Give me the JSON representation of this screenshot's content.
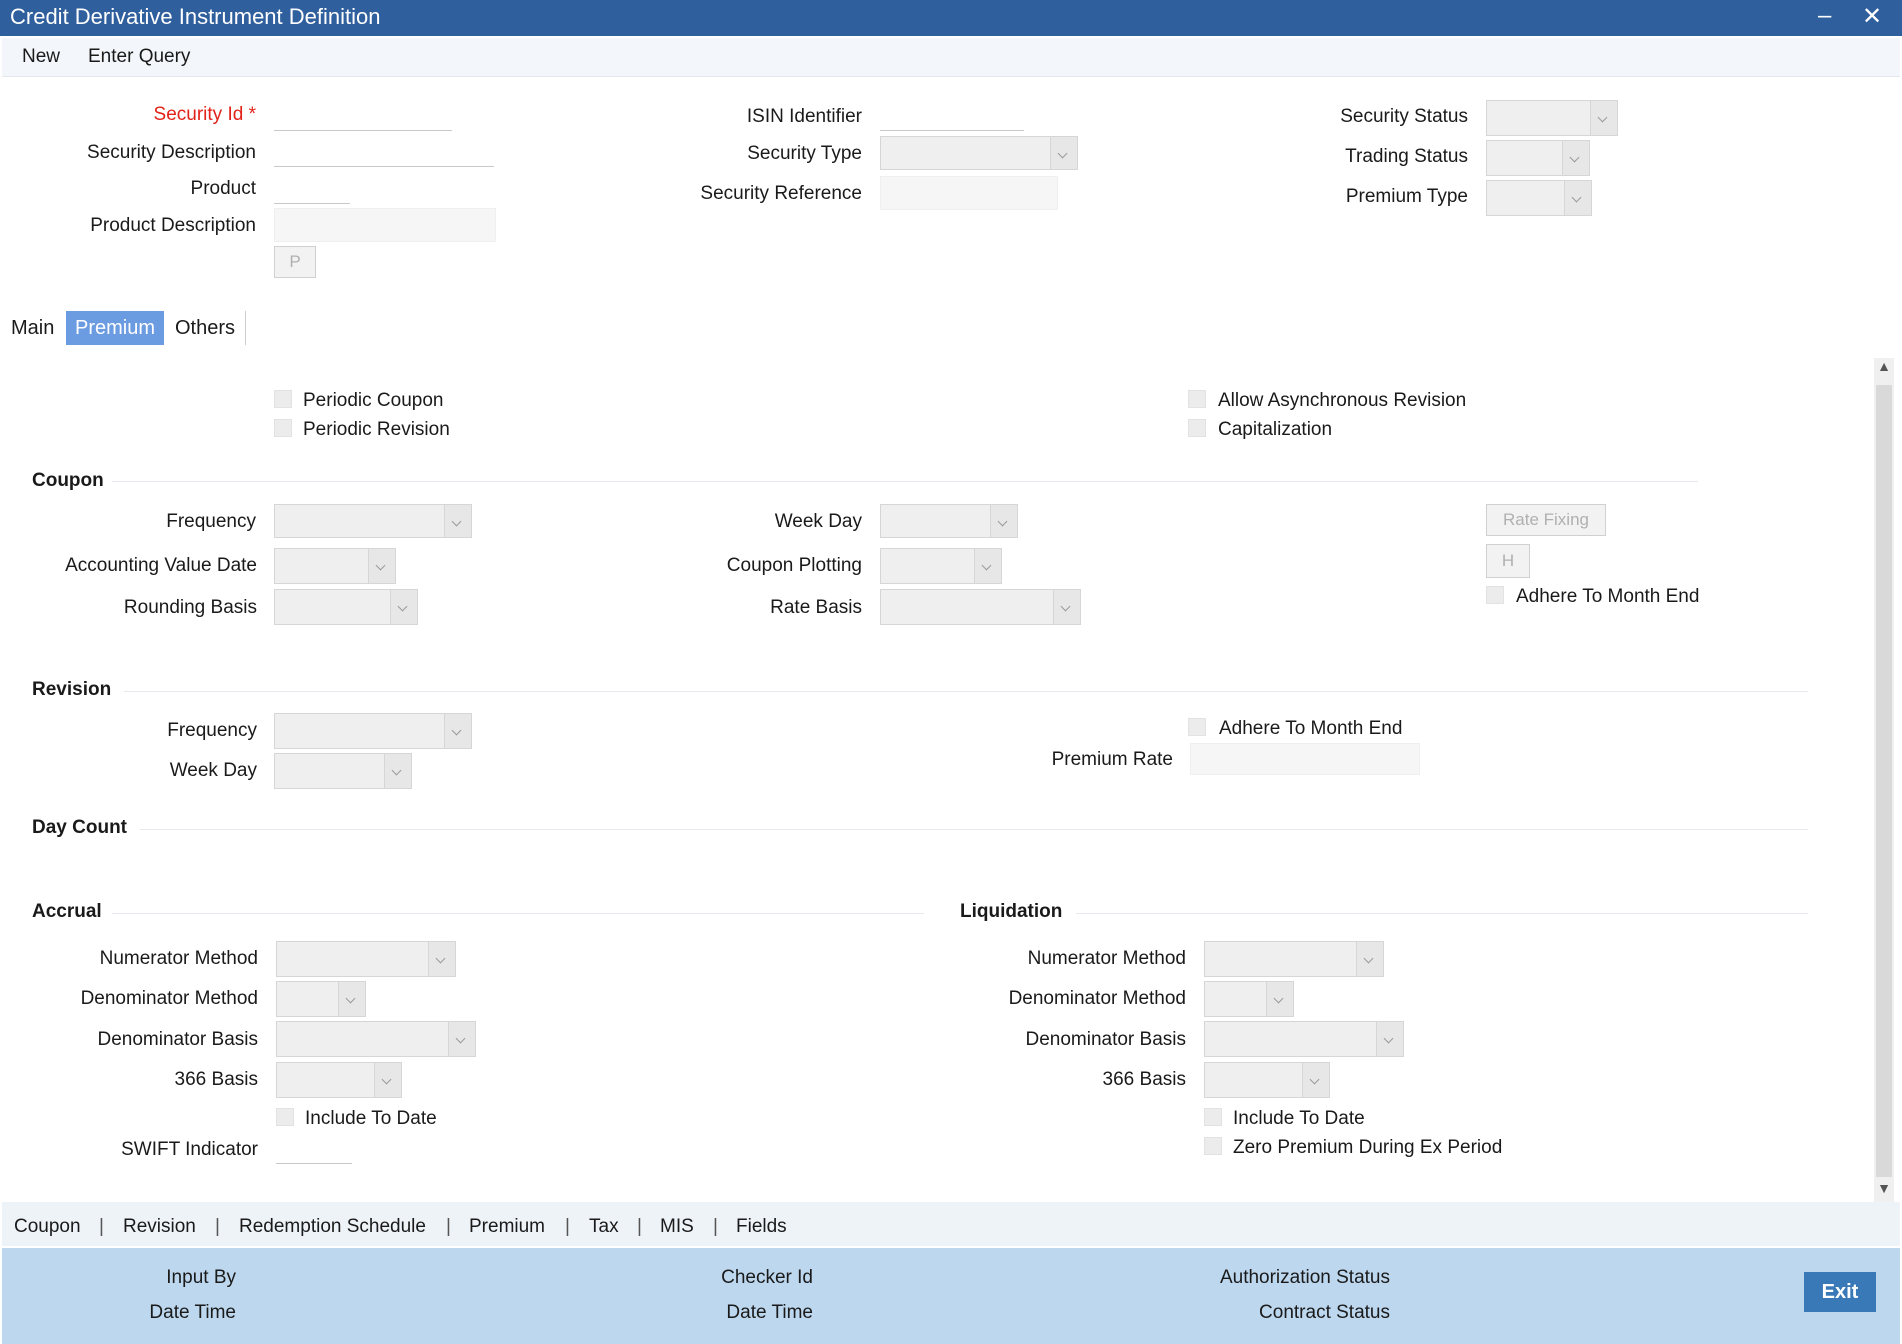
{
  "window": {
    "title": "Credit Derivative Instrument Definition",
    "minimize": "‒",
    "close": "✕"
  },
  "menu": {
    "new": "New",
    "enter_query": "Enter Query"
  },
  "header": {
    "security_id": "Security Id",
    "required_mark": "*",
    "security_description": "Security Description",
    "product": "Product",
    "product_description": "Product Description",
    "p_button": "P",
    "isin_identifier": "ISIN Identifier",
    "security_type": "Security Type",
    "security_reference": "Security Reference",
    "security_status": "Security Status",
    "trading_status": "Trading Status",
    "premium_type": "Premium Type"
  },
  "tabs": {
    "main": "Main",
    "premium": "Premium",
    "others": "Others",
    "active": "Premium"
  },
  "premium": {
    "periodic_coupon": "Periodic Coupon",
    "periodic_revision": "Periodic Revision",
    "allow_async_revision": "Allow Asynchronous Revision",
    "capitalization": "Capitalization",
    "coupon": {
      "title": "Coupon",
      "frequency": "Frequency",
      "accounting_value_date": "Accounting Value Date",
      "rounding_basis": "Rounding Basis",
      "week_day": "Week Day",
      "coupon_plotting": "Coupon Plotting",
      "rate_basis": "Rate Basis",
      "rate_fixing": "Rate Fixing",
      "h_button": "H",
      "adhere_to_month_end": "Adhere To Month End"
    },
    "revision": {
      "title": "Revision",
      "frequency": "Frequency",
      "week_day": "Week Day",
      "adhere_to_month_end": "Adhere To Month End",
      "premium_rate": "Premium Rate"
    },
    "day_count": {
      "title": "Day Count"
    },
    "accrual": {
      "title": "Accrual",
      "numerator_method": "Numerator Method",
      "denominator_method": "Denominator Method",
      "denominator_basis": "Denominator Basis",
      "basis_366": "366 Basis",
      "include_to_date": "Include To Date",
      "swift_indicator": "SWIFT Indicator"
    },
    "liquidation": {
      "title": "Liquidation",
      "numerator_method": "Numerator Method",
      "denominator_method": "Denominator Method",
      "denominator_basis": "Denominator Basis",
      "basis_366": "366 Basis",
      "include_to_date": "Include To Date",
      "zero_premium": "Zero Premium During Ex Period"
    }
  },
  "links": {
    "separator": "|",
    "items": [
      "Coupon",
      "Revision",
      "Redemption Schedule",
      "Premium",
      "Tax",
      "MIS",
      "Fields"
    ]
  },
  "footer": {
    "input_by": "Input By",
    "date_time_1": "Date Time",
    "checker_id": "Checker Id",
    "date_time_2": "Date Time",
    "authorization_status": "Authorization Status",
    "contract_status": "Contract Status",
    "exit": "Exit"
  },
  "colors": {
    "titlebar": "#2f5f9c",
    "active_tab": "#6b9be0",
    "footer": "#bcd7ee",
    "exit_button": "#3a79b8",
    "required": "#e2231a"
  }
}
